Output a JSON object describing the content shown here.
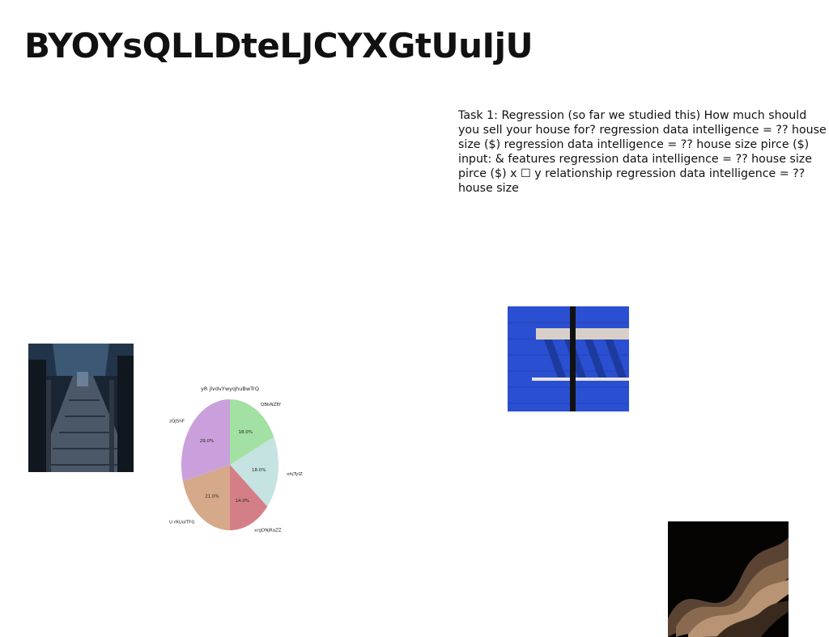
{
  "page": {
    "title": "BYOYsQLLDteLJCYXGtUuIjU",
    "body_text": "Task 1: Regression (so far we studied this) How much should you sell your house for? regression data intelligence = ?? house size ($) regression data intelligence = ?? house size pirce ($) input: & features regression data intelligence = ?? house size pirce ($) x ☐ y relationship regression data intelligence = ?? house size"
  },
  "images": {
    "bridge": "photo-wooden-bridge-night",
    "blue_wall": "photo-blue-wall-awning",
    "wave": "photo-abstract-brown-waves"
  },
  "chart_data": {
    "type": "pie",
    "title": "yR jlvdvYwyqhuBwTrQ",
    "labels": [
      "QBbNZEf",
      "ohjTyIZ",
      "xrgDNjRaZZ",
      "U rRUoITFG",
      "zQJShF"
    ],
    "values": [
      18.0,
      18.0,
      14.0,
      21.0,
      29.0
    ],
    "value_labels": [
      "18.0%",
      "18.0%",
      "14.0%",
      "21.0%",
      "29.0%"
    ],
    "colors": [
      "#a3e0a3",
      "#c5e3e0",
      "#d47f88",
      "#d5a98a",
      "#c9a0dc"
    ],
    "start": "top",
    "direction": "clockwise"
  }
}
